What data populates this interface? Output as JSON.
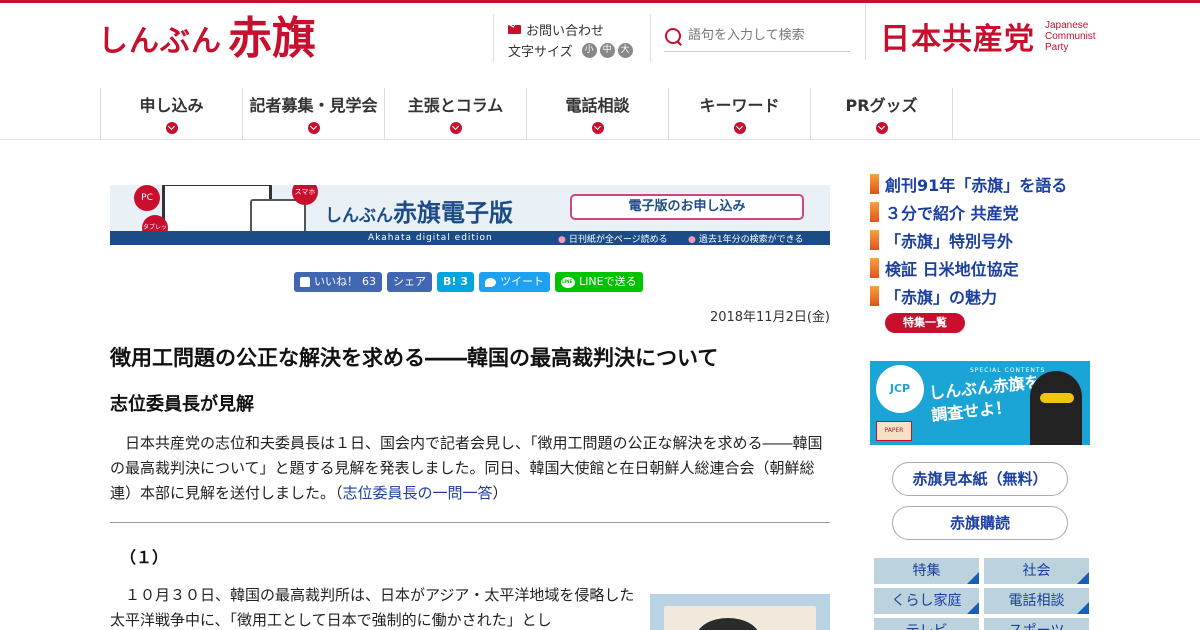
{
  "header": {
    "logo_sub": "しんぶん",
    "logo_main": "赤旗",
    "contact_label": "お問い合わせ",
    "fontsize_label": "文字サイズ",
    "fontsize_options": [
      "小",
      "中",
      "大"
    ],
    "search_placeholder": "語句を入力して検索",
    "party_name": "日本共産党",
    "party_en_1": "Japanese",
    "party_en_2": "Communist",
    "party_en_3": "Party",
    "brand_color": "#c8102e"
  },
  "nav": {
    "items": [
      {
        "label": "申し込み"
      },
      {
        "label": "記者募集・見学会"
      },
      {
        "label": "主張とコラム"
      },
      {
        "label": "電話相談"
      },
      {
        "label": "キーワード"
      },
      {
        "label": "PRグッズ"
      }
    ]
  },
  "banner": {
    "pc": "PC",
    "tablet": "タブレット",
    "phone": "スマホ",
    "title_sub": "しんぶん",
    "title_main": "赤旗電子版",
    "en": "Akahata digital edition",
    "apply": "電子版のお申し込み",
    "note1": "日刊紙が全ページ読める",
    "note2": "過去1年分の検索ができる"
  },
  "social": {
    "like": "いいね！",
    "like_count": "63",
    "share": "シェア",
    "hatena": "B!",
    "hatena_count": "3",
    "tweet": "ツイート",
    "line": "LINEで送る"
  },
  "article": {
    "date": "2018年11月2日(金)",
    "headline": "徴用工問題の公正な解決を求める――韓国の最高裁判決について",
    "subhead": "志位委員長が見解",
    "lead": "日本共産党の志位和夫委員長は１日、国会内で記者会見し、「徴用工問題の公正な解決を求める――韓国の最高裁判決について」と題する見解を発表しました。同日、韓国大使館と在日朝鮮人総連合会（朝鮮総連）本部に見解を送付しました。（",
    "lead_link": "志位委員長の一問一答",
    "lead_end": "）",
    "section": "（１）",
    "body": "１０月３０日、韓国の最高裁判所は、日本がアジア・太平洋地域を侵略した太平洋戦争中に、「徴用工として日本で強制的に働かされた」とし"
  },
  "sidebar": {
    "links": [
      {
        "label": "創刊91年「赤旗」を語る"
      },
      {
        "label": "３分で紹介 共産党"
      },
      {
        "label": "「赤旗」特別号外"
      },
      {
        "label": "検証 日米地位協定"
      },
      {
        "label": "「赤旗」の魅力"
      }
    ],
    "feature_list": "特集一覧",
    "promo_mark": "JCP",
    "promo_small": "SPECIAL CONTENTS",
    "promo_text1": "しんぶん赤旗を",
    "promo_text2": "調査せよ！",
    "promo_box": "PAPER",
    "sample": "赤旗見本紙（無料）",
    "subscribe": "赤旗購読",
    "grid": [
      {
        "label": "特集"
      },
      {
        "label": "社会"
      },
      {
        "label": "くらし家庭"
      },
      {
        "label": "電話相談"
      },
      {
        "label": "テレビ"
      },
      {
        "label": "スポーツ"
      }
    ]
  }
}
